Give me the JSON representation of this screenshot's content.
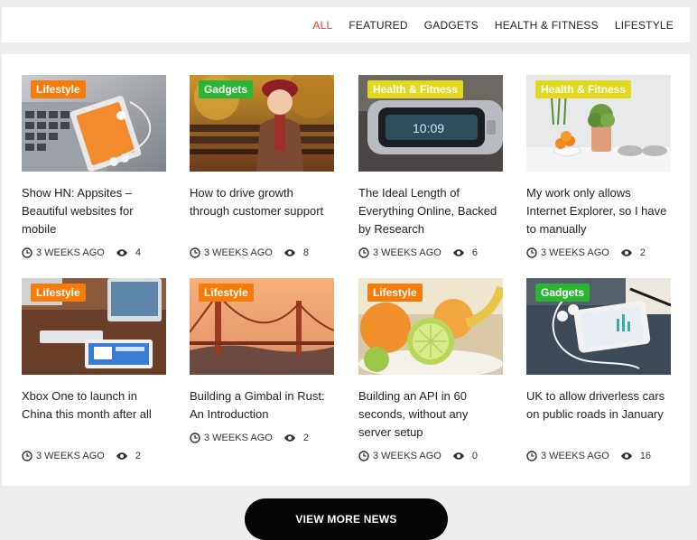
{
  "filters": [
    {
      "label": "ALL",
      "active": true
    },
    {
      "label": "FEATURED",
      "active": false
    },
    {
      "label": "GADGETS",
      "active": false
    },
    {
      "label": "HEALTH & FITNESS",
      "active": false
    },
    {
      "label": "LIFESTYLE",
      "active": false
    }
  ],
  "colors": {
    "accent": "#e8412c",
    "badge_lifestyle": "#f57c0a",
    "badge_gadgets": "#2bb534",
    "badge_health": "#e3d820"
  },
  "articles": [
    {
      "category": "Lifestyle",
      "title": "Show HN: Appsites – Beautiful websites for mobile",
      "time": "3 WEEKS AGO",
      "views": "4",
      "image": "laptop-phone-earbuds-photo"
    },
    {
      "category": "Gadgets",
      "title": "How to drive growth through customer support",
      "time": "3 WEEKS AGO",
      "views": "8",
      "image": "child-in-autumn-park-photo"
    },
    {
      "category": "Health & Fitness",
      "title": "The Ideal Length of Everything Online, Backed by Research",
      "time": "3 WEEKS AGO",
      "views": "6",
      "image": "smartwatch-photo"
    },
    {
      "category": "Health & Fitness",
      "title": "My work only allows Internet Explorer, so I have to manually",
      "time": "3 WEEKS AGO",
      "views": "2",
      "image": "oranges-plant-bowls-photo"
    },
    {
      "category": "Lifestyle",
      "title": "Xbox One to launch in China this month after all",
      "time": "3 WEEKS AGO",
      "views": "2",
      "image": "imac-keyboard-tablet-photo"
    },
    {
      "category": "Lifestyle",
      "title": "Building a Gimbal in Rust: An Introduction",
      "time": "3 WEEKS AGO",
      "views": "2",
      "image": "golden-gate-bridge-photo"
    },
    {
      "category": "Lifestyle",
      "title": "Building an API in 60 seconds, without any server setup",
      "time": "3 WEEKS AGO",
      "views": "0",
      "image": "citrus-fruit-bowl-photo"
    },
    {
      "category": "Gadgets",
      "title": "UK to allow driverless cars on public roads in January",
      "time": "3 WEEKS AGO",
      "views": "16",
      "image": "smartphone-earphones-photo"
    }
  ],
  "more_button": {
    "label": "VIEW MORE NEWS"
  }
}
